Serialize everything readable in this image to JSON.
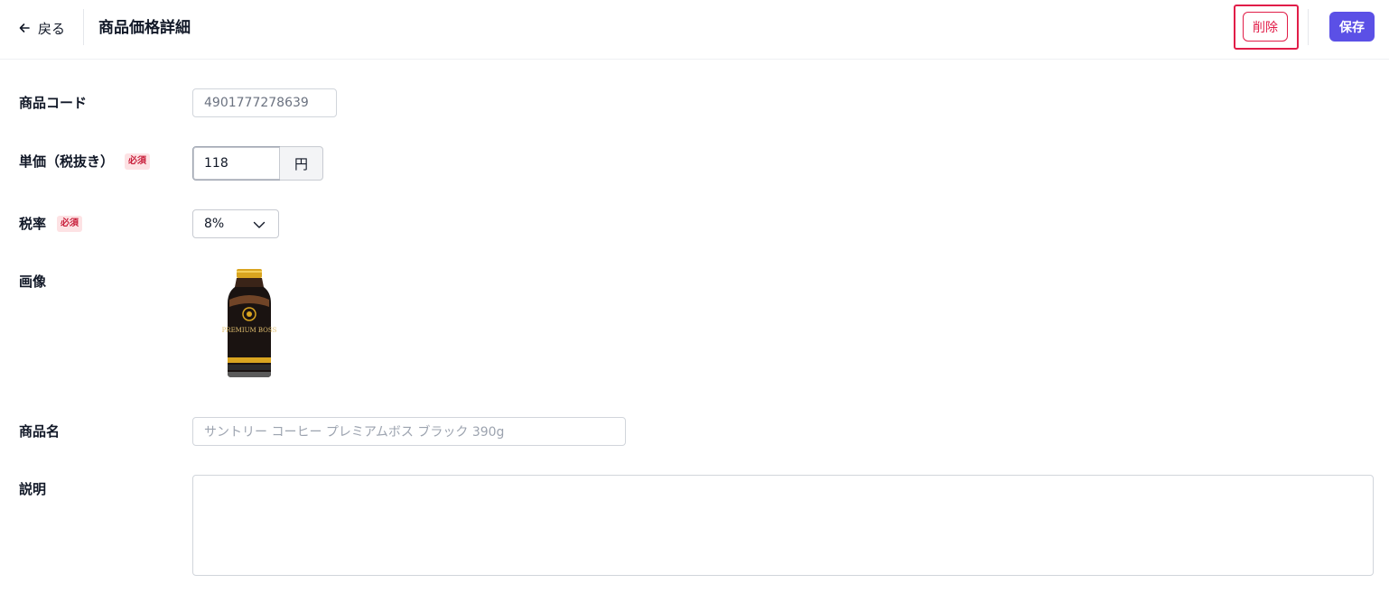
{
  "header": {
    "back_label": "戻る",
    "title": "商品価格詳細",
    "delete_label": "削除",
    "save_label": "保存"
  },
  "form": {
    "product_code": {
      "label": "商品コード",
      "value": "4901777278639"
    },
    "unit_price": {
      "label": "単価（税抜き）",
      "required_badge": "必須",
      "value": "118",
      "unit": "円"
    },
    "tax_rate": {
      "label": "税率",
      "required_badge": "必須",
      "selected": "8%"
    },
    "image": {
      "label": "画像",
      "alt_text": "PREMIUM BOSS"
    },
    "product_name": {
      "label": "商品名",
      "placeholder": "サントリー コーヒー プレミアムボス ブラック 390g"
    },
    "description": {
      "label": "説明",
      "value": ""
    }
  },
  "colors": {
    "accent": "#5b50e6",
    "danger": "#e11d48",
    "required_bg": "#fde2e4"
  },
  "icons": {
    "back": "arrow-left-icon",
    "select": "chevron-down-icon"
  }
}
